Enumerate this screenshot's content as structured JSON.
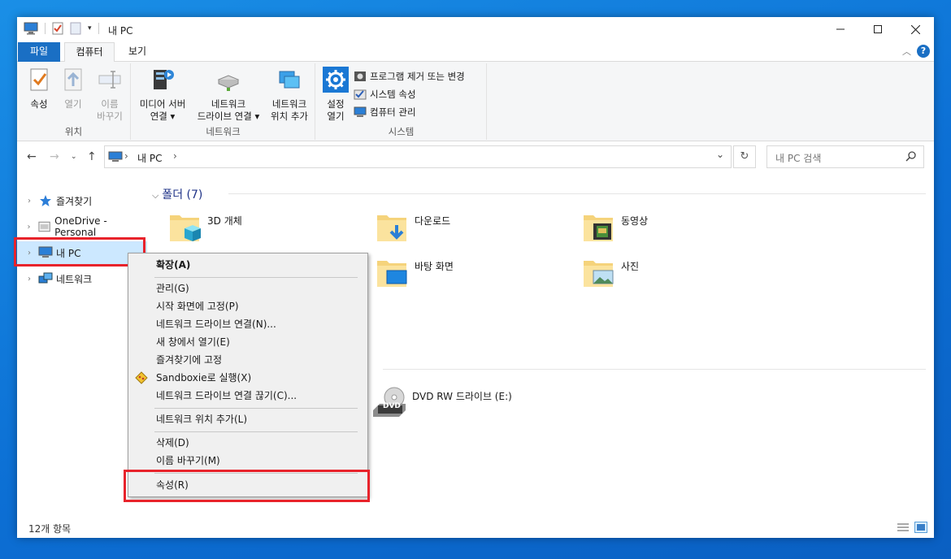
{
  "window": {
    "title": "내 PC",
    "quick_access_icons": [
      "computer-icon",
      "checkmark-properties-icon",
      "new-folder-icon",
      "customize-dropdown-icon"
    ]
  },
  "ribbon": {
    "tabs": [
      {
        "label": "파일"
      },
      {
        "label": "컴퓨터"
      },
      {
        "label": "보기"
      }
    ],
    "groups": {
      "location": {
        "label": "위치",
        "buttons": [
          {
            "label1": "속성",
            "label2": ""
          },
          {
            "label1": "열기",
            "label2": ""
          },
          {
            "label1": "이름",
            "label2": "바꾸기"
          }
        ]
      },
      "network": {
        "label": "네트워크",
        "buttons": [
          {
            "label1": "미디어 서버",
            "label2": "연결 ▾"
          },
          {
            "label1": "네트워크",
            "label2": "드라이브 연결 ▾"
          },
          {
            "label1": "네트워크",
            "label2": "위치 추가"
          }
        ]
      },
      "system": {
        "label": "시스템",
        "settings_label1": "설정",
        "settings_label2": "열기",
        "items": [
          {
            "label": "프로그램 제거 또는 변경"
          },
          {
            "label": "시스템 속성"
          },
          {
            "label": "컴퓨터 관리"
          }
        ]
      }
    }
  },
  "address_bar": {
    "path": "내 PC",
    "separator": "›",
    "search_placeholder": "내 PC 검색"
  },
  "nav_pane": {
    "items": [
      {
        "label": "즐겨찾기",
        "icon": "star-icon"
      },
      {
        "label": "OneDrive - Personal",
        "icon": "onedrive-icon"
      },
      {
        "label": "내 PC",
        "icon": "computer-icon",
        "selected": true
      },
      {
        "label": "네트워크",
        "icon": "network-icon"
      }
    ]
  },
  "content": {
    "folders_header": "폴더 (7)",
    "folders": [
      {
        "name": "3D 개체",
        "icon": "3d-objects-folder-icon"
      },
      {
        "name": "다운로드",
        "icon": "downloads-folder-icon"
      },
      {
        "name": "동영상",
        "icon": "videos-folder-icon"
      },
      {
        "name": "바탕 화면",
        "icon": "desktop-folder-icon"
      },
      {
        "name": "사진",
        "icon": "pictures-folder-icon"
      }
    ],
    "drives": [
      {
        "name": "DVD RW 드라이브 (E:)",
        "icon": "dvd-drive-icon",
        "badge": "DVD"
      }
    ]
  },
  "context_menu": {
    "items": [
      {
        "label": "확장(A)",
        "bold": true
      },
      {
        "label": "관리(G)"
      },
      {
        "label": "시작 화면에 고정(P)"
      },
      {
        "label": "네트워크 드라이브 연결(N)..."
      },
      {
        "label": "새 창에서 열기(E)"
      },
      {
        "label": "즐겨찾기에 고정"
      },
      {
        "label": "Sandboxie로 실행(X)",
        "icon": "sandboxie-icon"
      },
      {
        "label": "네트워크 드라이브 연결 끊기(C)..."
      },
      {
        "label": "네트워크 위치 추가(L)"
      },
      {
        "label": "삭제(D)"
      },
      {
        "label": "이름 바꾸기(M)"
      },
      {
        "label": "속성(R)"
      }
    ]
  },
  "status_bar": {
    "item_count": "12개 항목"
  },
  "colors": {
    "accent": "#1a6fc4",
    "selection": "#cce8ff",
    "highlight_box": "#e8232b",
    "section_header": "#1e3287"
  }
}
